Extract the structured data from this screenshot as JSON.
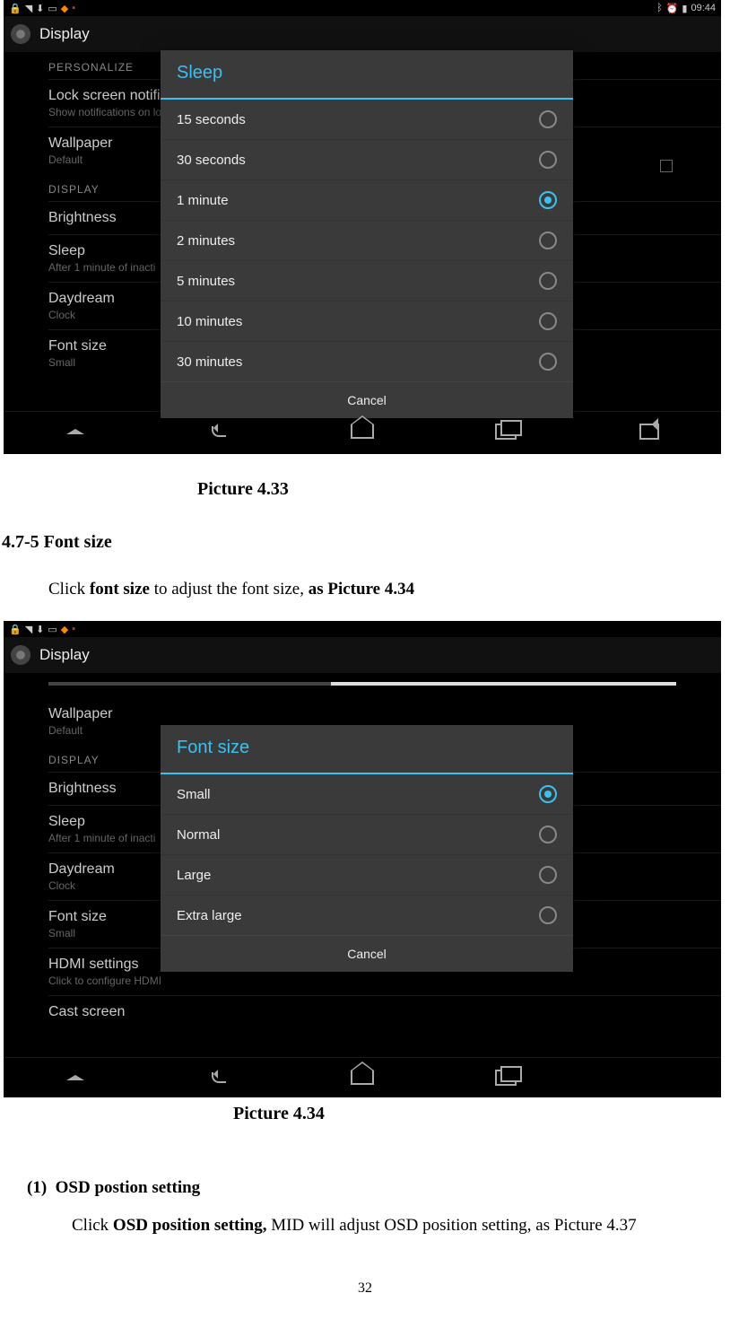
{
  "doc": {
    "caption1": "Picture 4.33",
    "section": "4.7-5 Font size",
    "body_pre": "Click ",
    "body_bold1": "font size",
    "body_mid": " to adjust the font size, ",
    "body_bold2": "as Picture 4.34",
    "caption2": "Picture 4.34",
    "osd_num": "(1)",
    "osd_h": "OSD postion setting",
    "osd_body_pre": "Click ",
    "osd_body_bold": "OSD position setting,",
    "osd_body_rest": " MID will adjust OSD position setting, as Picture 4.37",
    "page_number": "32"
  },
  "shot1": {
    "time": "09:44",
    "header": "Display",
    "cat_personalize": "PERSONALIZE",
    "cat_display": "DISPLAY",
    "rows": {
      "lockscreen_t": "Lock screen notific",
      "lockscreen_s": "Show notifications on lo",
      "wallpaper_t": "Wallpaper",
      "wallpaper_s": "Default",
      "brightness": "Brightness",
      "sleep_t": "Sleep",
      "sleep_s": "After 1 minute of inacti",
      "daydream_t": "Daydream",
      "daydream_s": "Clock",
      "font_t": "Font size",
      "font_s": "Small"
    },
    "dialog": {
      "title": "Sleep",
      "options": [
        "15 seconds",
        "30 seconds",
        "1 minute",
        "2 minutes",
        "5 minutes",
        "10 minutes",
        "30 minutes"
      ],
      "selected_index": 2,
      "cancel": "Cancel"
    }
  },
  "shot2": {
    "header": "Display",
    "cat_display": "DISPLAY",
    "rows": {
      "wallpaper_t": "Wallpaper",
      "wallpaper_s": "Default",
      "brightness": "Brightness",
      "sleep_t": "Sleep",
      "sleep_s": "After 1 minute of inacti",
      "daydream_t": "Daydream",
      "daydream_s": "Clock",
      "font_t": "Font size",
      "font_s": "Small",
      "hdmi_t": "HDMI settings",
      "hdmi_s": "Click to configure HDMI",
      "cast_t": "Cast screen"
    },
    "dialog": {
      "title": "Font size",
      "options": [
        "Small",
        "Normal",
        "Large",
        "Extra large"
      ],
      "selected_index": 0,
      "cancel": "Cancel"
    }
  }
}
